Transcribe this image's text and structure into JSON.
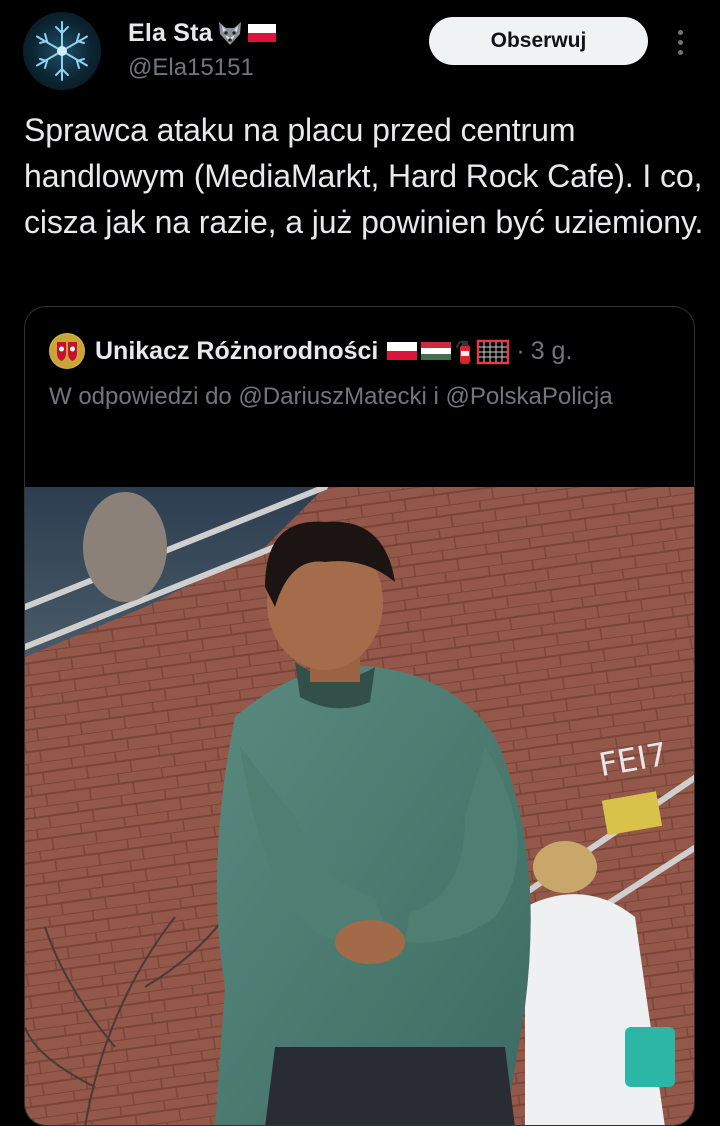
{
  "author": {
    "display_name": "Ela Sta",
    "name_emojis": [
      "wolf-face-emoji",
      "poland-flag-emoji"
    ],
    "handle": "@Ela15151",
    "avatar": "snowflake-avatar"
  },
  "follow_button": {
    "label": "Obserwuj"
  },
  "more_button": {
    "icon": "more-vertical-icon"
  },
  "tweet": {
    "text": "Sprawca ataku na placu przed centrum handlowym (MediaMarkt, Hard Rock Cafe). I co, cisza jak na razie, a już powinien być uziemiony."
  },
  "quote": {
    "avatar": "coat-of-arms-avatar",
    "author_name": "Unikacz Różnorodności",
    "name_emojis": [
      "poland-flag-emoji",
      "hungary-flag-emoji",
      "fire-extinguisher-emoji",
      "goal-net-emoji"
    ],
    "separator": "·",
    "time": "3 g.",
    "reply_text": "W odpowiedzi do @DariuszMatecki i @PolskaPolicja",
    "image": "photo-young-man-green-sweatshirt"
  },
  "colors": {
    "background": "#000000",
    "text_primary": "#e7e9ea",
    "text_secondary": "#71767b",
    "border": "#2f3336",
    "button_bg": "#eff3f4",
    "button_text": "#0f1419"
  }
}
